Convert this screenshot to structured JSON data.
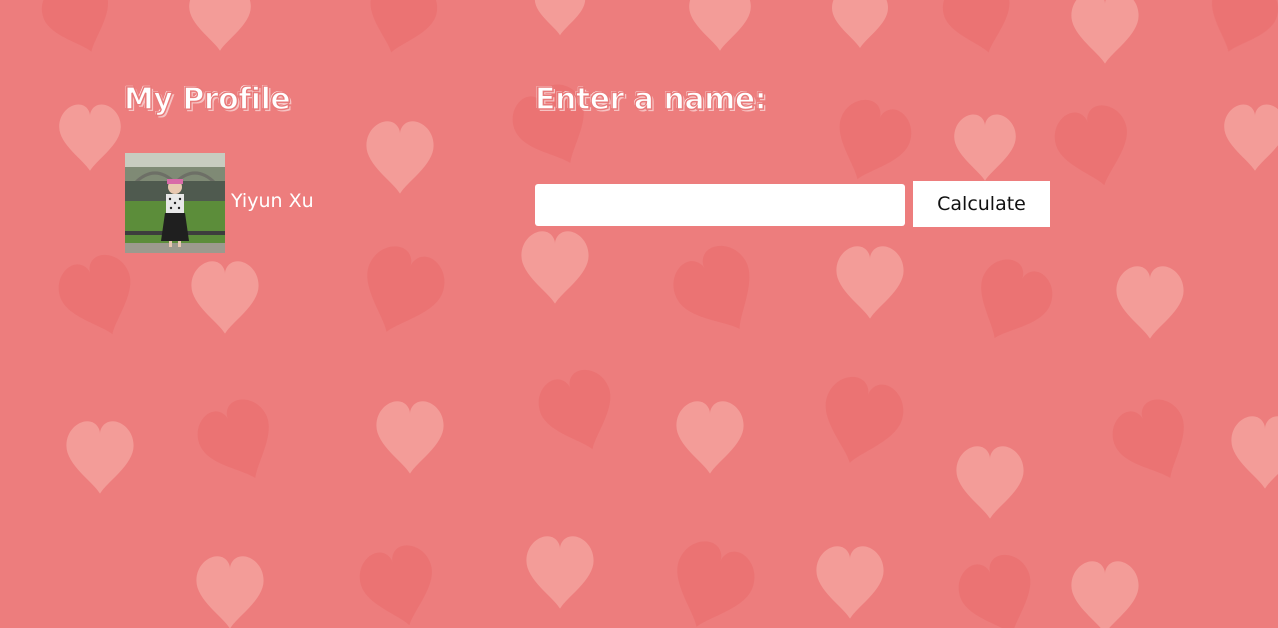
{
  "profile": {
    "heading": "My Profile",
    "name": "Yiyun Xu"
  },
  "calculator": {
    "heading": "Enter a name:",
    "input_value": "",
    "input_placeholder": "",
    "button_label": "Calculate"
  },
  "colors": {
    "background": "#ed7d7d",
    "heart_light": "#f4a29d",
    "heart_dark": "#ea6c6c",
    "text": "#ffffff",
    "input_bg": "#ffffff",
    "button_bg": "#ffffff",
    "button_text": "#111111"
  }
}
